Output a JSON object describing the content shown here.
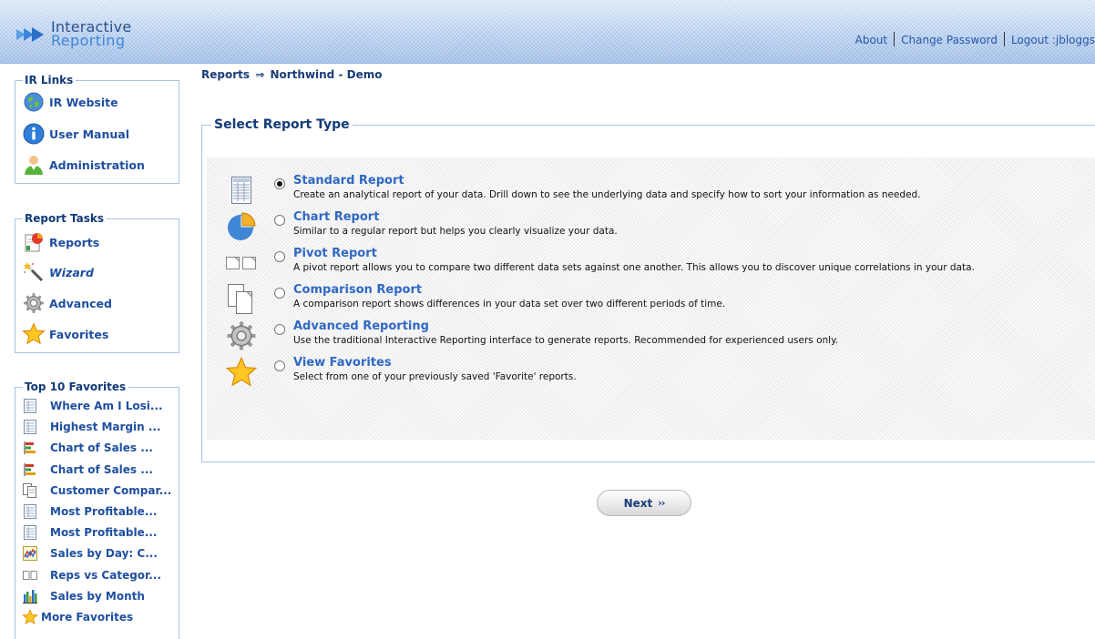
{
  "header": {
    "logo_line1": "Interactive",
    "logo_line2": "Reporting",
    "links": {
      "about": "About",
      "change_password": "Change Password",
      "logout": "Logout :jbloggs"
    }
  },
  "sidebar": {
    "ir_links": {
      "title": "IR Links",
      "items": [
        {
          "label": "IR Website",
          "icon": "globe-icon"
        },
        {
          "label": "User Manual",
          "icon": "info-icon"
        },
        {
          "label": "Administration",
          "icon": "user-icon"
        }
      ]
    },
    "report_tasks": {
      "title": "Report Tasks",
      "items": [
        {
          "label": "Reports",
          "icon": "reports-icon"
        },
        {
          "label": "Wizard",
          "icon": "wand-icon"
        },
        {
          "label": "Advanced",
          "icon": "gear-icon"
        },
        {
          "label": "Favorites",
          "icon": "star-icon"
        }
      ]
    },
    "top_favorites": {
      "title": "Top 10 Favorites",
      "items": [
        {
          "label": "Where Am I Losi...",
          "icon": "table-icon"
        },
        {
          "label": "Highest Margin ...",
          "icon": "table-icon"
        },
        {
          "label": "Chart of Sales ...",
          "icon": "bar-chart-icon"
        },
        {
          "label": "Chart of Sales ...",
          "icon": "bar-chart-icon"
        },
        {
          "label": "Customer Compar...",
          "icon": "compare-icon"
        },
        {
          "label": "Most Profitable...",
          "icon": "table-icon"
        },
        {
          "label": "Most Profitable...",
          "icon": "table-icon"
        },
        {
          "label": "Sales by Day: C...",
          "icon": "line-chart-icon"
        },
        {
          "label": "Reps vs Categor...",
          "icon": "pivot-icon"
        },
        {
          "label": "Sales by Month",
          "icon": "column-chart-icon"
        }
      ],
      "more": "More Favorites"
    }
  },
  "breadcrumb": {
    "root": "Reports",
    "arrow": "⇒",
    "current": "Northwind - Demo"
  },
  "main": {
    "title": "Select Report Type",
    "options": [
      {
        "title": "Standard Report",
        "desc": "Create an analytical report of your data. Drill down to see the underlying data and specify how to sort your information as needed.",
        "checked": true,
        "icon": "standard-report-icon"
      },
      {
        "title": "Chart Report",
        "desc": "Similar to a regular report but helps you clearly visualize your data.",
        "checked": false,
        "icon": "pie-chart-icon"
      },
      {
        "title": "Pivot Report",
        "desc": "A pivot report allows you to compare two different data sets against one another. This allows you to discover unique correlations in your data.",
        "checked": false,
        "icon": "pivot-icon"
      },
      {
        "title": "Comparison Report",
        "desc": "A comparison report shows differences in your data set over two different periods of time.",
        "checked": false,
        "icon": "compare-icon"
      },
      {
        "title": "Advanced Reporting",
        "desc": "Use the traditional Interactive Reporting interface to generate reports. Recommended for experienced users only.",
        "checked": false,
        "icon": "gear-icon"
      },
      {
        "title": "View Favorites",
        "desc": "Select from one of your previously saved 'Favorite' reports.",
        "checked": false,
        "icon": "star-icon"
      }
    ],
    "next_label": "Next",
    "next_chevron": "››"
  }
}
